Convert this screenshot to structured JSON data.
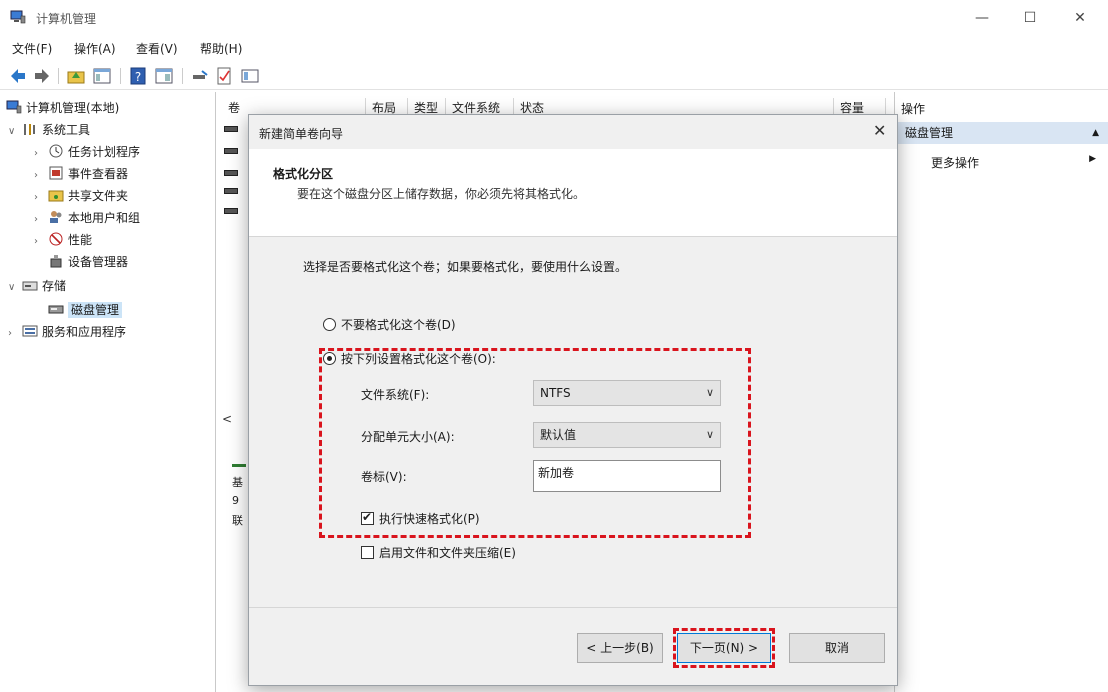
{
  "window": {
    "title": "计算机管理",
    "minimize_glyph": "—",
    "maximize_glyph": "☐",
    "close_glyph": "✕"
  },
  "menu": [
    "文件(F)",
    "操作(A)",
    "查看(V)",
    "帮助(H)"
  ],
  "tree": {
    "root": "计算机管理(本地)",
    "system_tools": "系统工具",
    "task_scheduler": "任务计划程序",
    "event_viewer": "事件查看器",
    "shared_folders": "共享文件夹",
    "local_users": "本地用户和组",
    "performance": "性能",
    "device_manager": "设备管理器",
    "storage": "存储",
    "disk_management": "磁盘管理",
    "services_apps": "服务和应用程序",
    "collapse_glyph": "∨",
    "expand_glyph": "›"
  },
  "columns": [
    "卷",
    "布局",
    "类型",
    "文件系统",
    "状态",
    "容量"
  ],
  "midpane": {
    "scroll_left": "<",
    "frag1": "基",
    "frag2": "9",
    "frag3": "联"
  },
  "actions": {
    "header": "操作",
    "section": "磁盘管理",
    "section_glyph": "▲",
    "more": "更多操作",
    "more_glyph": "▶"
  },
  "dialog": {
    "title": "新建简单卷向导",
    "close_glyph": "✕",
    "heading": "格式化分区",
    "subheading": "要在这个磁盘分区上储存数据，你必须先将其格式化。",
    "instruction": "选择是否要格式化这个卷；如果要格式化，要使用什么设置。",
    "option_no_format": "不要格式化这个卷(D)",
    "option_format": "按下列设置格式化这个卷(O):",
    "fs_label": "文件系统(F):",
    "fs_value": "NTFS",
    "alloc_label": "分配单元大小(A):",
    "alloc_value": "默认值",
    "volume_label": "卷标(V):",
    "volume_value": "新加卷",
    "quick_format": "执行快速格式化(P)",
    "compression": "启用文件和文件夹压缩(E)",
    "caret": "∨",
    "back_button": "< 上一步(B)",
    "next_button": "下一页(N) >",
    "cancel_button": "取消"
  },
  "colors": {
    "highlight": "#d9141d",
    "selection": "#cce4f7",
    "action_section": "#d9e5f3"
  }
}
